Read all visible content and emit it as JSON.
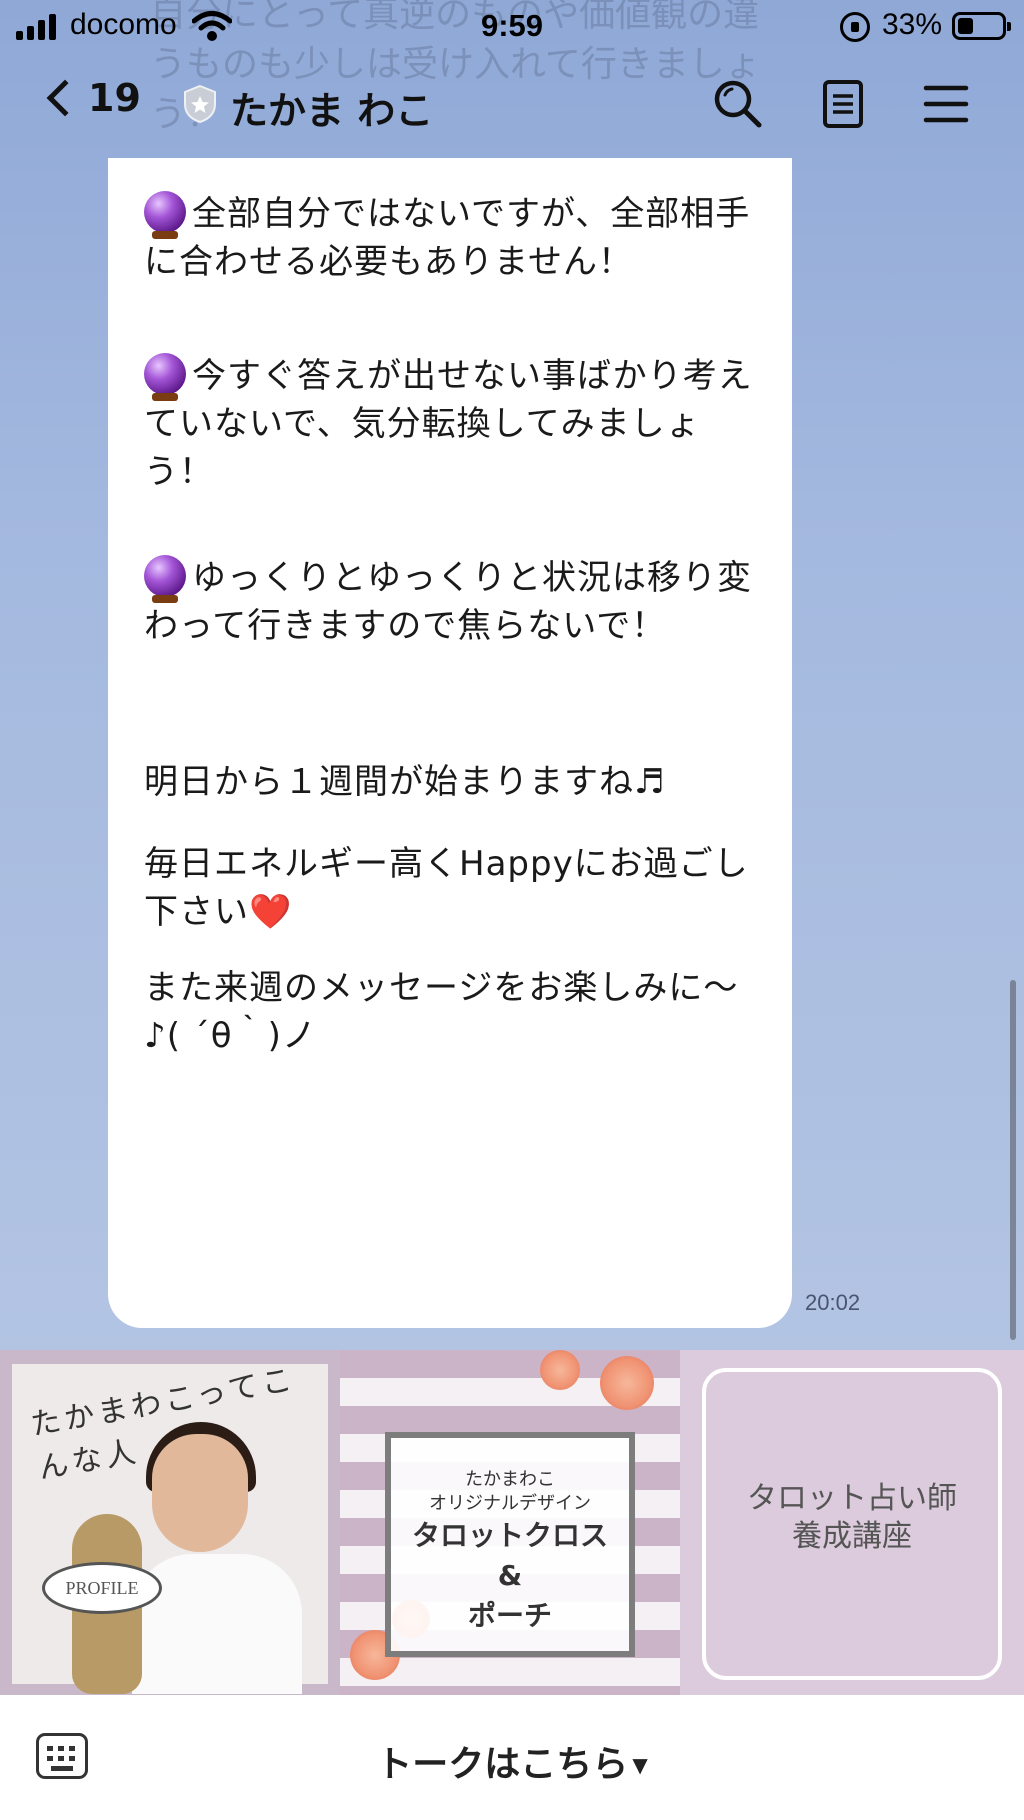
{
  "status": {
    "carrier": "docomo",
    "time": "9:59",
    "battery": "33%"
  },
  "header": {
    "back_count": "19",
    "title": "たかま わこ"
  },
  "ghost_text": "自分にとって真逆のものや価値観の違うものも少しは受け入れて行きましょう！",
  "message": {
    "p1": "全部自分ではないですが、全部相手に合わせる必要もありません！",
    "p2": "今すぐ答えが出せない事ばかり考えていないで、気分転換してみましょう！",
    "p3": "ゆっくりとゆっくりと状況は移り変わって行きますので焦らないで！",
    "p4": "明日から１週間が始まりますね♬",
    "p5": "毎日エネルギー高くHappyにお過ごし下さい❤️",
    "p6": "また来週のメッセージをお楽しみに〜♪( ´θ｀)ノ",
    "time": "20:02"
  },
  "rich_menu": {
    "profile_arc": "たかまわこってこんな人",
    "profile_badge": "PROFILE",
    "tarot_sub1": "たかまわこ",
    "tarot_sub2": "オリジナルデザイン",
    "tarot_main1": "タロットクロス",
    "tarot_main2": "&",
    "tarot_main3": "ポーチ",
    "course_line1": "タロット占い師",
    "course_line2": "養成講座"
  },
  "bottom": {
    "talk_label": "トークはこちら"
  },
  "colors": {
    "chat_bg": "#9fb5d9",
    "bubble": "#ffffff",
    "rich_menu_bg": "#d9c9d8"
  }
}
